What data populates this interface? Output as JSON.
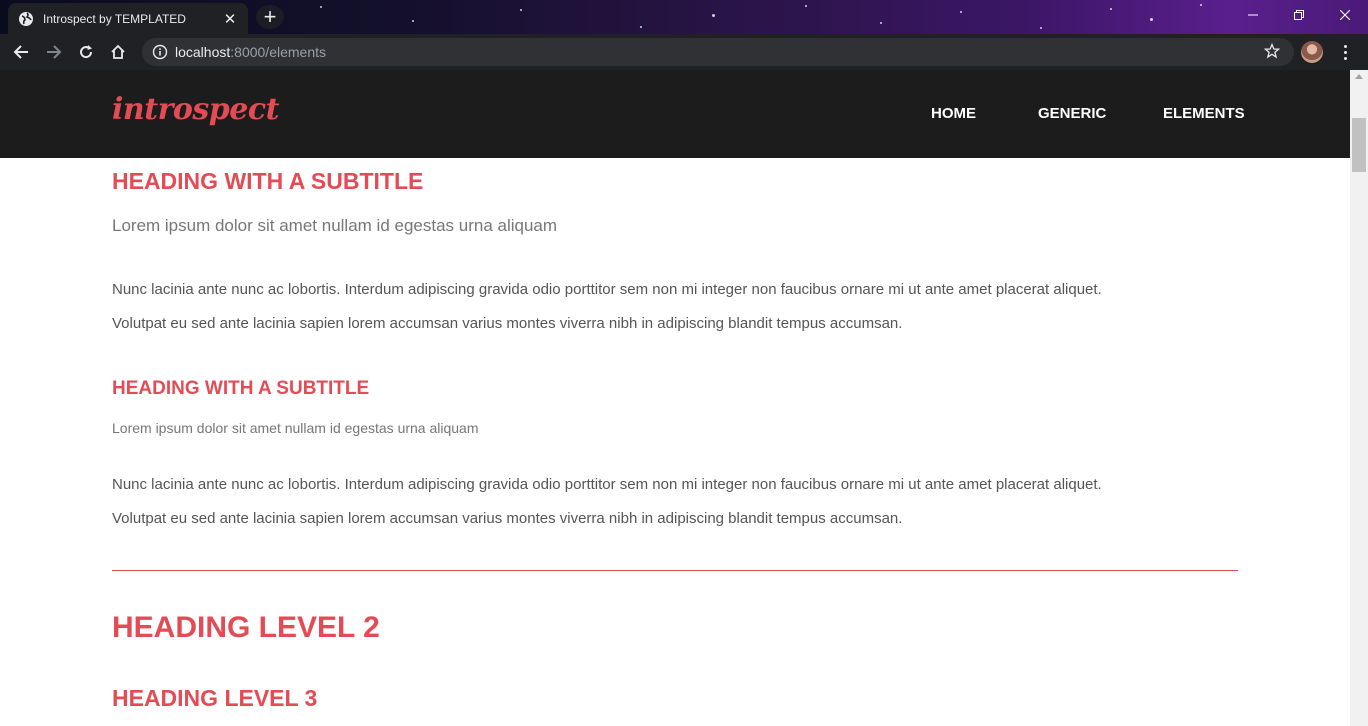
{
  "browser": {
    "tab_title": "Introspect by TEMPLATED",
    "close_glyph": "✕",
    "new_tab_glyph": "+",
    "url_host": "localhost",
    "url_path": ":8000/elements"
  },
  "site": {
    "logo": "introspect",
    "nav": [
      "HOME",
      "GENERIC",
      "ELEMENTS"
    ]
  },
  "content": {
    "section1": {
      "heading": "HEADING WITH A SUBTITLE",
      "subtitle": "Lorem ipsum dolor sit amet nullam id egestas urna aliquam",
      "paragraph_line1": "Nunc lacinia ante nunc ac lobortis. Interdum adipiscing gravida odio porttitor sem non mi integer non faucibus ornare mi ut ante amet placerat aliquet.",
      "paragraph_line2": "Volutpat eu sed ante lacinia sapien lorem accumsan varius montes viverra nibh in adipiscing blandit tempus accumsan."
    },
    "section2": {
      "heading": "HEADING WITH A SUBTITLE",
      "subtitle": "Lorem ipsum dolor sit amet nullam id egestas urna aliquam",
      "paragraph_line1": "Nunc lacinia ante nunc ac lobortis. Interdum adipiscing gravida odio porttitor sem non mi integer non faucibus ornare mi ut ante amet placerat aliquet.",
      "paragraph_line2": "Volutpat eu sed ante lacinia sapien lorem accumsan varius montes viverra nibh in adipiscing blandit tempus accumsan."
    },
    "heading_level_2": "HEADING LEVEL 2",
    "heading_level_3": "HEADING LEVEL 3"
  },
  "colors": {
    "accent": "#e44c55",
    "header_bg": "#1c1c1c",
    "chrome_bg": "#202124"
  }
}
